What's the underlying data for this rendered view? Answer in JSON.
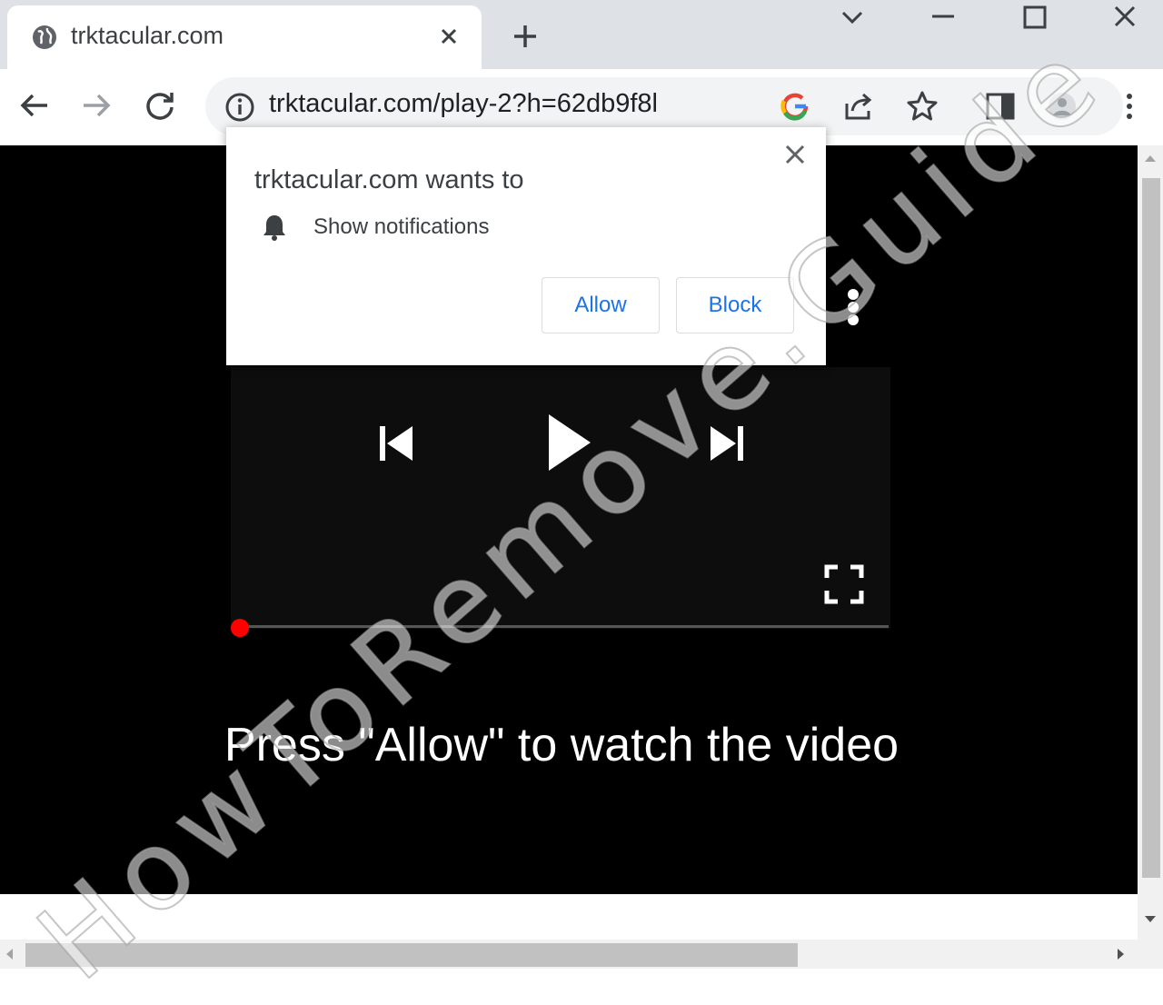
{
  "browser": {
    "tab": {
      "title": "trktacular.com",
      "icon": "globe-icon"
    },
    "address_bar": {
      "url": "trktacular.com/play-2?h=62db9f8l"
    }
  },
  "permission_prompt": {
    "title": "trktacular.com wants to",
    "permission": "Show notifications",
    "allow_label": "Allow",
    "block_label": "Block"
  },
  "page": {
    "cta_text": "Press \"Allow\" to watch the video",
    "player": {
      "progress": 0
    }
  },
  "watermark": {
    "text": "HowToRemove.Guide"
  },
  "colors": {
    "progress_dot": "#ff0000",
    "link_blue": "#1a73e8",
    "page_bg": "#000000"
  }
}
